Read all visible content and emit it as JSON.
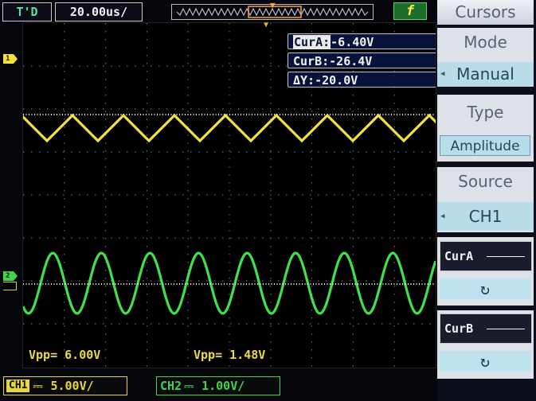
{
  "topbar": {
    "trigger_status": "T'D",
    "timebase": "20.00us/",
    "trigger_source_icon": "f"
  },
  "screen": {
    "ch1_marker": "1",
    "ch2_marker": "2",
    "cursor_readouts": [
      {
        "label": "CurA:",
        "value": "-6.40V"
      },
      {
        "label": "CurB:",
        "value": "-26.4V"
      },
      {
        "label": "ΔY:",
        "value": "-20.0V"
      }
    ],
    "measurements": {
      "ch1": "Vpp= 6.00V",
      "ch2": "Vpp= 1.48V"
    }
  },
  "bottombar": {
    "ch1_label": "CH1",
    "ch1_scale": "5.00V/",
    "ch2_label": "CH2",
    "ch2_scale": "1.00V/"
  },
  "menu": {
    "title": "Cursors",
    "mode_label": "Mode",
    "mode_value": "Manual",
    "type_label": "Type",
    "type_value": "Amplitude",
    "source_label": "Source",
    "source_value": "CH1",
    "cur_a_label": "CurA",
    "cur_b_label": "CurB"
  },
  "colors": {
    "ch1": "#f3e13e",
    "ch2": "#3fe24a",
    "cursor": "#f5f5f5",
    "measure_text": "#eadb3f"
  }
}
